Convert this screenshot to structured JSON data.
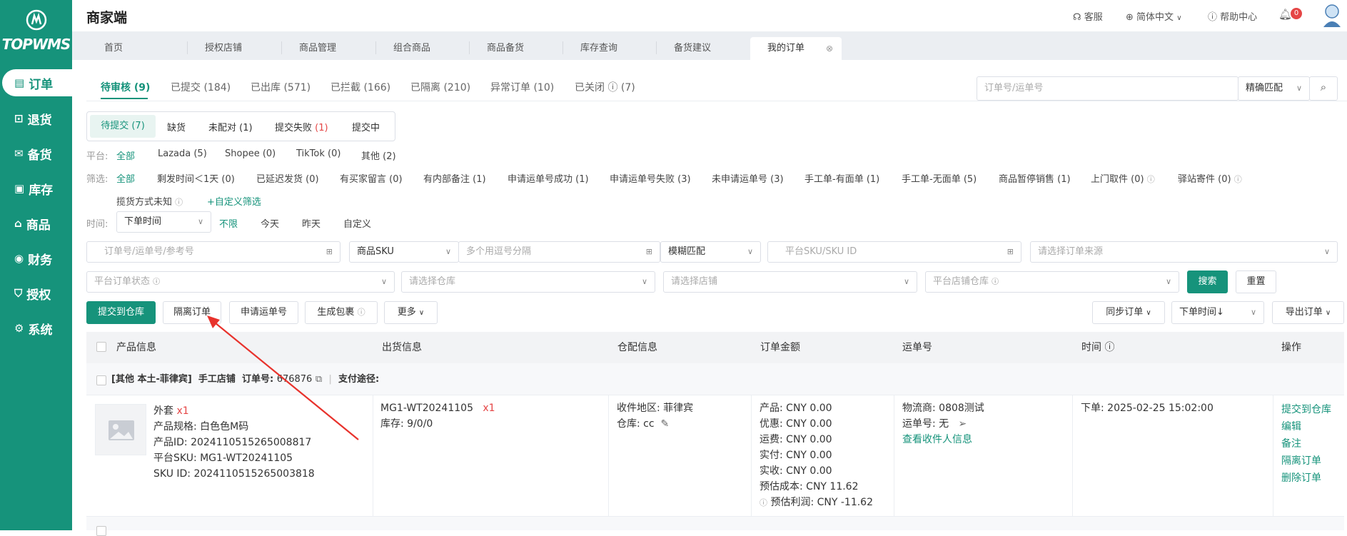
{
  "brand": {
    "name": "TOPWMS",
    "logo_icon": "wms-logo-icon"
  },
  "header": {
    "title": "商家端",
    "service": "客服",
    "language": "简体中文",
    "help": "帮助中心",
    "notif_count": "0"
  },
  "sidebar": {
    "items": [
      {
        "label": "订单",
        "icon": "order-icon",
        "active": true
      },
      {
        "label": "退货",
        "icon": "return-icon"
      },
      {
        "label": "备货",
        "icon": "stock-icon"
      },
      {
        "label": "库存",
        "icon": "inventory-icon"
      },
      {
        "label": "商品",
        "icon": "goods-icon"
      },
      {
        "label": "财务",
        "icon": "finance-icon"
      },
      {
        "label": "授权",
        "icon": "auth-icon"
      },
      {
        "label": "系统",
        "icon": "system-icon"
      }
    ]
  },
  "tabs": [
    {
      "label": "首页"
    },
    {
      "label": "授权店铺"
    },
    {
      "label": "商品管理"
    },
    {
      "label": "组合商品"
    },
    {
      "label": "商品备货"
    },
    {
      "label": "库存查询"
    },
    {
      "label": "备货建议"
    },
    {
      "label": "我的订单",
      "active": true
    }
  ],
  "status_tabs": [
    {
      "label": "待审核 (9)",
      "active": true
    },
    {
      "label": "已提交 (184)"
    },
    {
      "label": "已出库 (571)"
    },
    {
      "label": "已拦截 (166)"
    },
    {
      "label": "已隔离 (210)"
    },
    {
      "label": "异常订单 (10)"
    },
    {
      "label": "已关闭 ⓘ (7)"
    }
  ],
  "top_search": {
    "placeholder": "订单号/运单号",
    "match": "精确匹配"
  },
  "sub_tabs": [
    {
      "label": "待提交 (7)",
      "active": true
    },
    {
      "label": "缺货"
    },
    {
      "label": "未配对 (1)"
    },
    {
      "label": "提交失败",
      "count": "(1)"
    },
    {
      "label": "提交中"
    }
  ],
  "filters": {
    "platform_label": "平台:",
    "platform": [
      "全部",
      "Lazada (5)",
      "Shopee (0)",
      "TikTok (0)",
      "其他 (2)"
    ],
    "screen_label": "筛选:",
    "screen": [
      "全部",
      "剩发时间＜1天 (0)",
      "已延迟发货 (0)",
      "有买家留言 (0)",
      "有内部备注 (1)",
      "申请运单号成功 (1)",
      "申请运单号失败 (3)",
      "未申请运单号 (3)",
      "手工单-有面单 (1)",
      "手工单-无面单 (5)",
      "商品暂停销售 (1)",
      "上门取件 (0)",
      "驿站寄件 (0)"
    ],
    "screen2": "揽货方式未知",
    "custom": "+自定义筛选",
    "time_label": "时间:",
    "time_type": "下单时间",
    "time": [
      "不限",
      "今天",
      "昨天",
      "自定义"
    ]
  },
  "search": {
    "order_ph": "订单号/运单号/参考号",
    "sku_type": "商品SKU",
    "multi_ph": "多个用逗号分隔",
    "fuzzy": "模糊匹配",
    "platsku_ph": "平台SKU/SKU ID",
    "source_ph": "请选择订单来源",
    "status_ph": "平台订单状态",
    "warehouse_ph": "请选择仓库",
    "shop_ph": "请选择店铺",
    "platwh_ph": "平台店铺仓库",
    "search_btn": "搜索",
    "reset_btn": "重置"
  },
  "actions": {
    "submit": "提交到仓库",
    "isolate": "隔离订单",
    "apply": "申请运单号",
    "pack": "生成包裹",
    "more": "更多",
    "sync": "同步订单",
    "sort": "下单时间↓",
    "export": "导出订单"
  },
  "table": {
    "headers": [
      "产品信息",
      "出货信息",
      "仓配信息",
      "订单金额",
      "运单号",
      "时间 ⓘ",
      "操作"
    ]
  },
  "order": {
    "group": "[其他 本土-菲律宾]",
    "store": "手工店铺",
    "order_label": "订单号:",
    "order_no": "676876",
    "pay_label": "支付途径:",
    "product": {
      "name": "外套",
      "qty": "x1",
      "spec": "产品规格: 白色色M码",
      "id": "产品ID: 2024110515265008817",
      "plat_sku": "平台SKU: MG1-WT20241105",
      "sku_id": "SKU ID: 2024110515265003818"
    },
    "ship": {
      "sku": "MG1-WT20241105",
      "qty": "x1",
      "stock": "库存: 9/0/0"
    },
    "wh": {
      "region": "收件地区: 菲律宾",
      "warehouse": "仓库: cc"
    },
    "amount": [
      "产品: CNY 0.00",
      "优惠: CNY 0.00",
      "运费: CNY 0.00",
      "实付: CNY 0.00",
      "实收: CNY 0.00",
      "预估成本: CNY 11.62",
      "预估利润: CNY -11.62"
    ],
    "waybill": {
      "carrier": "物流商: 0808测试",
      "no": "运单号: 无",
      "view": "查看收件人信息"
    },
    "time": "下单: 2025-02-25 15:02:00",
    "ops": [
      "提交到仓库",
      "编辑",
      "备注",
      "隔离订单",
      "删除订单"
    ]
  },
  "colors": {
    "primary": "#16937b",
    "danger": "#e54545",
    "arrow": "#e8322c"
  }
}
